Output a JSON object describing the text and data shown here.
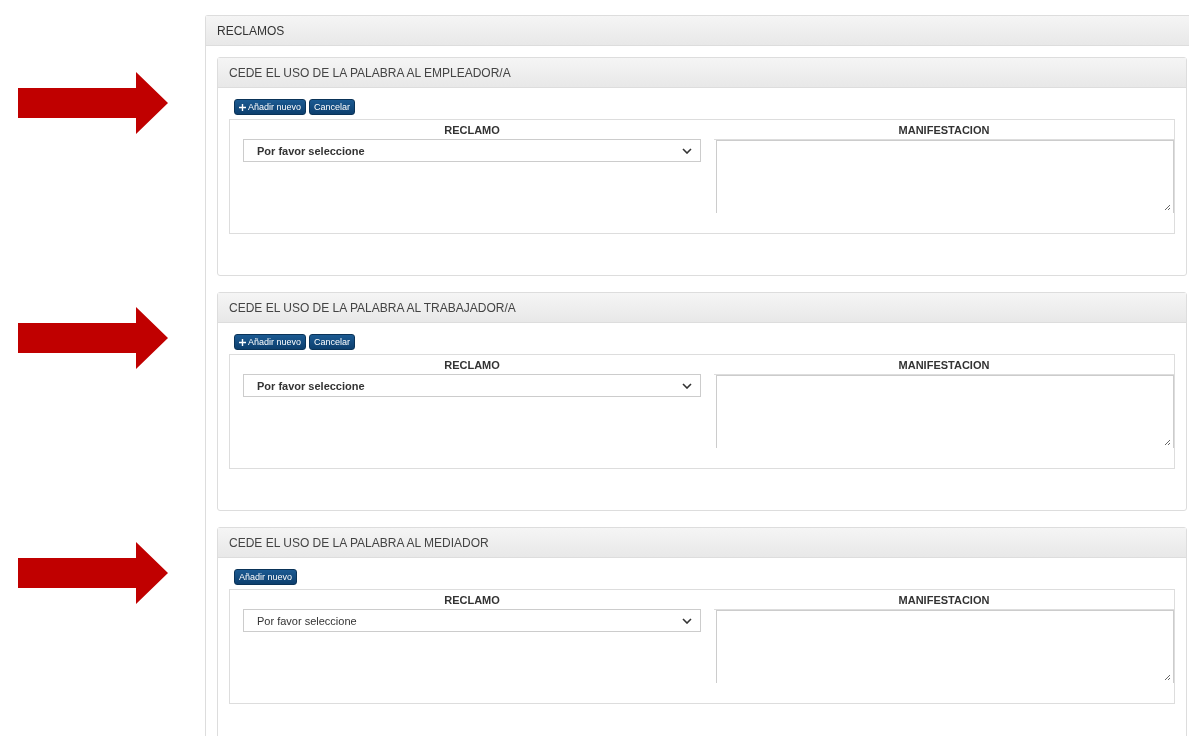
{
  "panel": {
    "title": "RECLAMOS"
  },
  "sections": [
    {
      "title": "CEDE EL USO DE LA PALABRA AL EMPLEADOR/A",
      "buttons": [
        {
          "label": "Añadir nuevo",
          "plus_icon": true
        },
        {
          "label": "Cancelar",
          "plus_icon": false
        }
      ],
      "columns": [
        "RECLAMO",
        "MANIFESTACION"
      ],
      "select": {
        "value": "Por favor seleccione",
        "bold": true
      }
    },
    {
      "title": "CEDE EL USO DE LA PALABRA AL TRABAJADOR/A",
      "buttons": [
        {
          "label": "Añadir nuevo",
          "plus_icon": true
        },
        {
          "label": "Cancelar",
          "plus_icon": false
        }
      ],
      "columns": [
        "RECLAMO",
        "MANIFESTACION"
      ],
      "select": {
        "value": "Por favor seleccione",
        "bold": true
      }
    },
    {
      "title": "CEDE EL USO DE LA PALABRA AL MEDIADOR",
      "buttons": [
        {
          "label": "Añadir nuevo",
          "plus_icon": false
        }
      ],
      "columns": [
        "RECLAMO",
        "MANIFESTACION"
      ],
      "select": {
        "value": "Por favor seleccione",
        "bold": false
      }
    }
  ]
}
